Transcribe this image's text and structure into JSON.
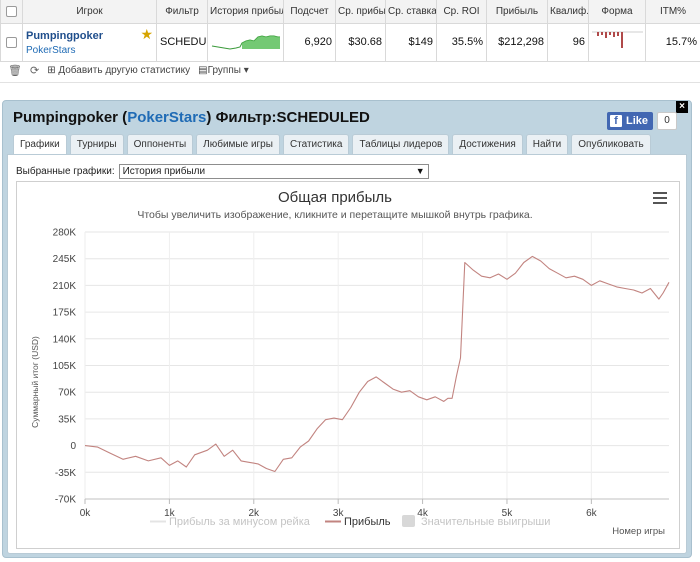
{
  "table": {
    "headers": [
      "Игрок",
      "Фильтр",
      "История прибыли",
      "Подсчет",
      "Ср. прибыль",
      "Ср. ставка",
      "Ср. ROI",
      "Прибыль",
      "Квалиф.",
      "Форма",
      "ITM%"
    ],
    "row": {
      "player": "Pumpingpoker",
      "site": "PokerStars",
      "filter": "SCHEDULED",
      "count": "6,920",
      "avg_profit": "$30.68",
      "avg_stake": "$149",
      "avg_roi": "35.5%",
      "profit": "$212,298",
      "ability": "96",
      "itm": "15.7%"
    }
  },
  "toolbar": {
    "add_stats": "Добавить другую статистику",
    "groups": "Группы"
  },
  "panel": {
    "title_player": "Pumpingpoker",
    "title_site": "PokerStars",
    "title_filter": "Фильтр:SCHEDULED",
    "like_label": "Like",
    "like_count": "0",
    "tabs": [
      "Графики",
      "Турниры",
      "Оппоненты",
      "Любимые игры",
      "Статистика",
      "Таблицы лидеров",
      "Достижения",
      "Найти",
      "Опубликовать"
    ],
    "select_label": "Выбранные графики:",
    "select_value": "История прибыли"
  },
  "icons": [
    "star-icon",
    "trash-icon",
    "refresh-icon",
    "plus-icon",
    "groups-icon",
    "chevron-down-icon",
    "close-icon",
    "facebook-icon",
    "menu-icon"
  ],
  "chart_data": {
    "type": "line",
    "title": "Общая прибыль",
    "subtitle": "Чтобы увеличить изображение, кликните и перетащите мышкой внутрь графика.",
    "xlabel": "Номер игры",
    "ylabel": "Суммарный итог (USD)",
    "xlim": [
      0,
      6920
    ],
    "ylim": [
      -70000,
      280000
    ],
    "x_ticks": [
      "0k",
      "1k",
      "2k",
      "3k",
      "4k",
      "5k",
      "6k"
    ],
    "y_ticks": [
      "-70K",
      "-35K",
      "0",
      "35K",
      "70K",
      "105K",
      "140K",
      "175K",
      "210K",
      "245K",
      "280K"
    ],
    "legend": [
      "Прибыль за минусом рейка",
      "Прибыль",
      "Значительные выигрыши"
    ],
    "legend_placement": "bottom",
    "grid": true,
    "series": [
      {
        "name": "Прибыль",
        "color": "#c28480",
        "x": [
          0,
          150,
          300,
          450,
          600,
          750,
          900,
          1000,
          1100,
          1200,
          1300,
          1450,
          1550,
          1650,
          1750,
          1850,
          1950,
          2050,
          2150,
          2250,
          2350,
          2450,
          2550,
          2650,
          2750,
          2850,
          2950,
          3050,
          3150,
          3250,
          3350,
          3450,
          3550,
          3650,
          3750,
          3850,
          3950,
          4050,
          4150,
          4250,
          4300,
          4350,
          4400,
          4450,
          4500,
          4600,
          4700,
          4800,
          4900,
          5000,
          5100,
          5200,
          5300,
          5400,
          5500,
          5600,
          5700,
          5800,
          5900,
          6000,
          6100,
          6200,
          6300,
          6400,
          6500,
          6600,
          6700,
          6800,
          6850,
          6920
        ],
        "y": [
          0,
          -2000,
          -10000,
          -18000,
          -14000,
          -20000,
          -16000,
          -26000,
          -20000,
          -28000,
          -12000,
          -6000,
          2000,
          -14000,
          -6000,
          -20000,
          -22000,
          -24000,
          -30000,
          -34000,
          -18000,
          -16000,
          -2000,
          6000,
          22000,
          34000,
          36000,
          34000,
          50000,
          70000,
          84000,
          90000,
          82000,
          74000,
          70000,
          72000,
          64000,
          60000,
          64000,
          58000,
          62000,
          62000,
          90000,
          115000,
          240000,
          230000,
          222000,
          220000,
          225000,
          218000,
          226000,
          240000,
          248000,
          242000,
          232000,
          226000,
          220000,
          222000,
          218000,
          210000,
          216000,
          212000,
          208000,
          206000,
          204000,
          200000,
          206000,
          192000,
          200000,
          214000
        ]
      }
    ]
  }
}
